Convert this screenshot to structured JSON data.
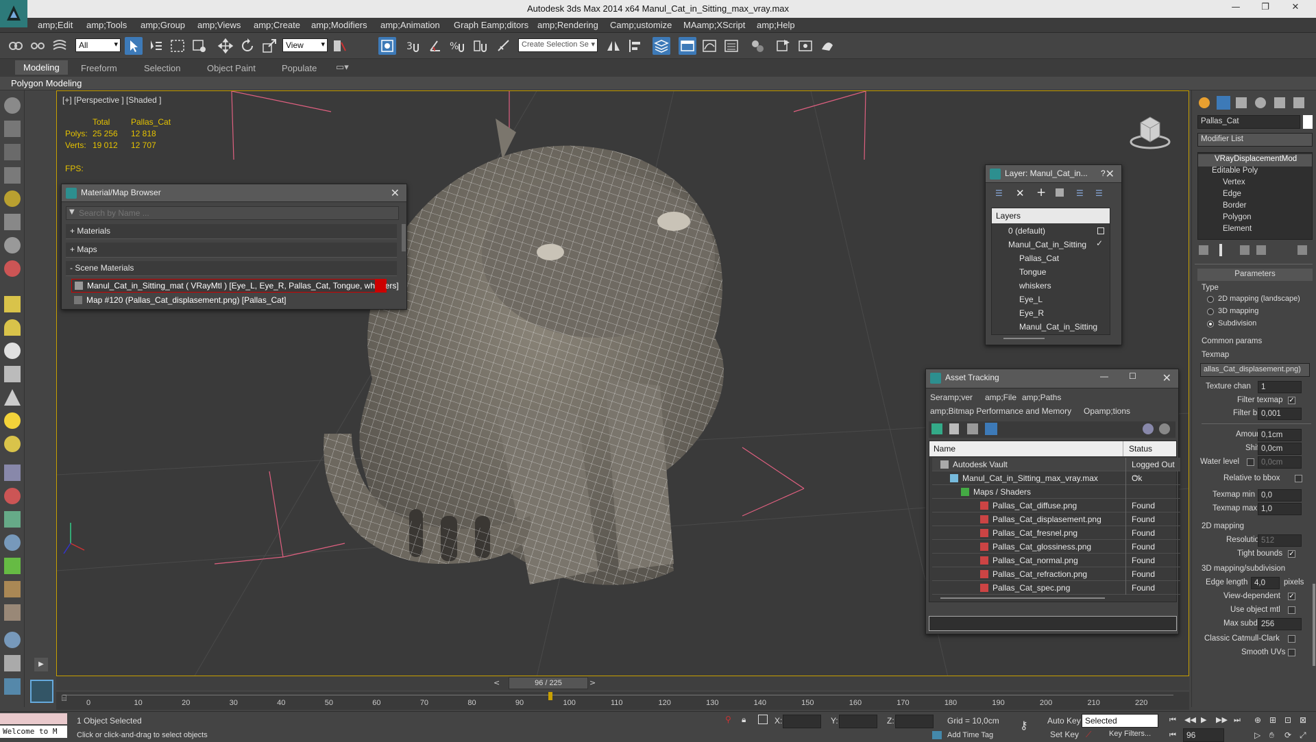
{
  "window": {
    "title": "Autodesk 3ds Max  2014 x64     Manul_Cat_in_Sitting_max_vray.max",
    "minimize": "—",
    "restore": "❐",
    "close": "✕"
  },
  "menu": [
    "amp;Edit",
    "amp;Tools",
    "amp;Group",
    "amp;Views",
    "amp;Create",
    "amp;Modifiers",
    "amp;Animation",
    "Graph Eamp;ditors",
    "amp;Rendering",
    "Camp;ustomize",
    "MAamp;XScript",
    "amp;Help"
  ],
  "toolbar": {
    "selection_filter": "All",
    "ref_coord": "View",
    "named_selection": "Create Selection Se"
  },
  "ribbon": {
    "tabs": [
      "Modeling",
      "Freeform",
      "Selection",
      "Object Paint",
      "Populate"
    ],
    "sub_label": "Polygon Modeling"
  },
  "viewport": {
    "label": "[+] [Perspective ] [Shaded ]",
    "stats": {
      "col_total": "Total",
      "col_object": "Pallas_Cat",
      "polys_label": "Polys:",
      "polys_total": "25 256",
      "polys_object": "12 818",
      "verts_label": "Verts:",
      "verts_total": "19 012",
      "verts_object": "12 707",
      "fps_label": "FPS:"
    }
  },
  "material_browser": {
    "title": "Material/Map Browser",
    "search_placeholder": "Search by Name ...",
    "sections": [
      "+ Materials",
      "+ Maps",
      "- Scene Materials"
    ],
    "items": [
      "Manul_Cat_in_Sitting_mat  ( VRayMtl ) [Eye_L, Eye_R, Pallas_Cat, Tongue, whiskers]",
      "Map #120 (Pallas_Cat_displasement.png) [Pallas_Cat]"
    ]
  },
  "layer_panel": {
    "title": "Layer: Manul_Cat_in...",
    "help": "?",
    "header": "Layers",
    "rows": [
      "0 (default)",
      "Manul_Cat_in_Sitting",
      "Pallas_Cat",
      "Tongue",
      "whiskers",
      "Eye_L",
      "Eye_R",
      "Manul_Cat_in_Sitting"
    ]
  },
  "asset_tracking": {
    "title": "Asset Tracking",
    "menu": [
      "Seramp;ver",
      "amp;File",
      "amp;Paths",
      "amp;Bitmap Performance and Memory",
      "Opamp;tions"
    ],
    "col_name": "Name",
    "col_status": "Status",
    "rows": [
      {
        "name": "Autodesk Vault",
        "status": "Logged Out ..."
      },
      {
        "name": "Manul_Cat_in_Sitting_max_vray.max",
        "status": "Ok"
      },
      {
        "name": "Maps / Shaders",
        "status": ""
      },
      {
        "name": "Pallas_Cat_diffuse.png",
        "status": "Found"
      },
      {
        "name": "Pallas_Cat_displasement.png",
        "status": "Found"
      },
      {
        "name": "Pallas_Cat_fresnel.png",
        "status": "Found"
      },
      {
        "name": "Pallas_Cat_glossiness.png",
        "status": "Found"
      },
      {
        "name": "Pallas_Cat_normal.png",
        "status": "Found"
      },
      {
        "name": "Pallas_Cat_refraction.png",
        "status": "Found"
      },
      {
        "name": "Pallas_Cat_spec.png",
        "status": "Found"
      }
    ]
  },
  "command_panel": {
    "object_name": "Pallas_Cat",
    "modifier_list": "Modifier List",
    "stack": [
      "VRayDisplacementMod",
      "Editable Poly",
      "Vertex",
      "Edge",
      "Border",
      "Polygon",
      "Element"
    ],
    "rollout": "Parameters",
    "type_label": "Type",
    "type_options": [
      "2D mapping (landscape)",
      "3D mapping",
      "Subdivision"
    ],
    "common_params": "Common params",
    "texmap_label": "Texmap",
    "texmap_value": "allas_Cat_displasement.png)",
    "texture_chan_label": "Texture chan",
    "texture_chan": "1",
    "filter_texmap": "Filter texmap",
    "filter_blur_label": "Filter blur",
    "filter_blur": "0,001",
    "amount_label": "Amount",
    "amount": "0,1cm",
    "shift_label": "Shift",
    "shift": "0,0cm",
    "water_level_label": "Water level",
    "water_level": "0,0cm",
    "relative_bbox": "Relative to bbox",
    "texmap_min_label": "Texmap min",
    "texmap_min": "0,0",
    "texmap_max_label": "Texmap max",
    "texmap_max": "1,0",
    "mapping2d": "2D mapping",
    "resolution_label": "Resolution",
    "resolution": "512",
    "tight_bounds": "Tight bounds",
    "mapping3d": "3D mapping/subdivision",
    "edge_length_label": "Edge length",
    "edge_length": "4,0",
    "pixels": "pixels",
    "view_dependent": "View-dependent",
    "use_object_mtl": "Use object mtl",
    "max_subdivs_label": "Max subdivs",
    "max_subdivs": "256",
    "catmull": "Classic Catmull-Clark",
    "smooth_uvs": "Smooth UVs"
  },
  "timeline": {
    "frame": "96 / 225",
    "frame_fraction": 0.4267,
    "ticks": [
      "0",
      "10",
      "20",
      "30",
      "40",
      "50",
      "60",
      "70",
      "80",
      "90",
      "100",
      "110",
      "120",
      "130",
      "140",
      "150",
      "160",
      "170",
      "180",
      "190",
      "200",
      "210",
      "220"
    ]
  },
  "status": {
    "maxscript": "Welcome to M",
    "selected": "1 Object Selected",
    "prompt": "Click or click-and-drag to select objects",
    "x_label": "X:",
    "y_label": "Y:",
    "z_label": "Z:",
    "grid": "Grid = 10,0cm",
    "add_time_tag": "Add Time Tag",
    "auto_key": "Auto Key",
    "selected_dropdown": "Selected",
    "set_key": "Set Key",
    "key_filters": "Key Filters...",
    "current_frame": "96"
  },
  "colors": {
    "viewport_border": "#c8a000",
    "stats_text": "#e6c300",
    "active_tool": "#3d7ab8",
    "selected_material": "#cc0000",
    "logo": "#2d7a7a"
  }
}
